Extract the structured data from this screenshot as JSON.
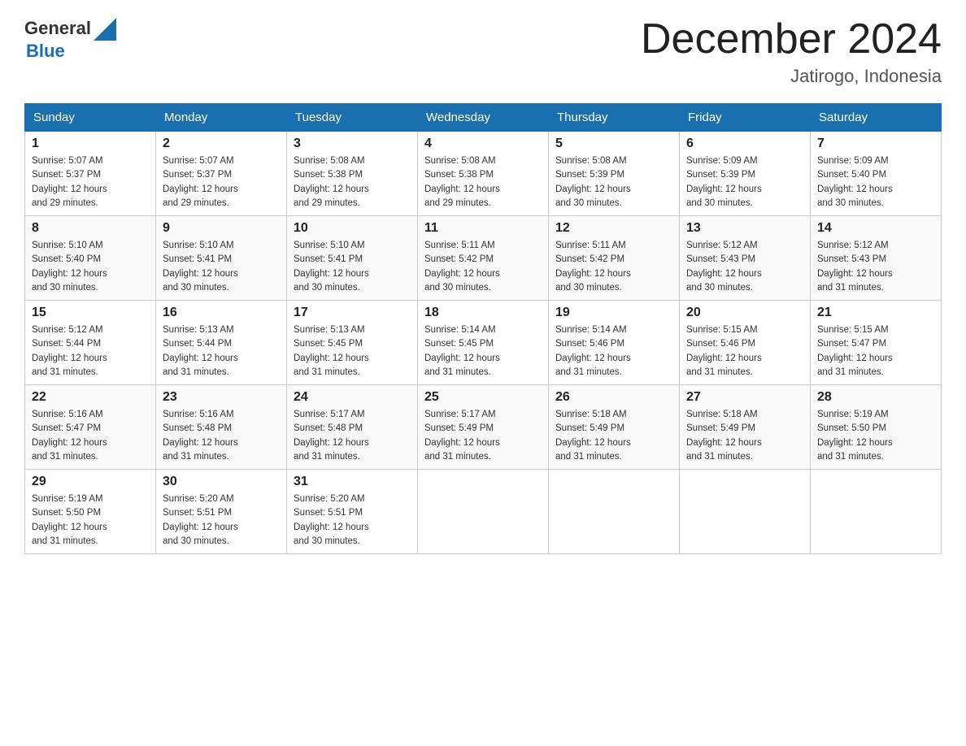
{
  "header": {
    "logo_text_general": "General",
    "logo_text_blue": "Blue",
    "month_title": "December 2024",
    "location": "Jatirogo, Indonesia"
  },
  "days_of_week": [
    "Sunday",
    "Monday",
    "Tuesday",
    "Wednesday",
    "Thursday",
    "Friday",
    "Saturday"
  ],
  "weeks": [
    {
      "days": [
        {
          "number": "1",
          "sunrise": "5:07 AM",
          "sunset": "5:37 PM",
          "daylight": "12 hours and 29 minutes."
        },
        {
          "number": "2",
          "sunrise": "5:07 AM",
          "sunset": "5:37 PM",
          "daylight": "12 hours and 29 minutes."
        },
        {
          "number": "3",
          "sunrise": "5:08 AM",
          "sunset": "5:38 PM",
          "daylight": "12 hours and 29 minutes."
        },
        {
          "number": "4",
          "sunrise": "5:08 AM",
          "sunset": "5:38 PM",
          "daylight": "12 hours and 29 minutes."
        },
        {
          "number": "5",
          "sunrise": "5:08 AM",
          "sunset": "5:39 PM",
          "daylight": "12 hours and 30 minutes."
        },
        {
          "number": "6",
          "sunrise": "5:09 AM",
          "sunset": "5:39 PM",
          "daylight": "12 hours and 30 minutes."
        },
        {
          "number": "7",
          "sunrise": "5:09 AM",
          "sunset": "5:40 PM",
          "daylight": "12 hours and 30 minutes."
        }
      ]
    },
    {
      "days": [
        {
          "number": "8",
          "sunrise": "5:10 AM",
          "sunset": "5:40 PM",
          "daylight": "12 hours and 30 minutes."
        },
        {
          "number": "9",
          "sunrise": "5:10 AM",
          "sunset": "5:41 PM",
          "daylight": "12 hours and 30 minutes."
        },
        {
          "number": "10",
          "sunrise": "5:10 AM",
          "sunset": "5:41 PM",
          "daylight": "12 hours and 30 minutes."
        },
        {
          "number": "11",
          "sunrise": "5:11 AM",
          "sunset": "5:42 PM",
          "daylight": "12 hours and 30 minutes."
        },
        {
          "number": "12",
          "sunrise": "5:11 AM",
          "sunset": "5:42 PM",
          "daylight": "12 hours and 30 minutes."
        },
        {
          "number": "13",
          "sunrise": "5:12 AM",
          "sunset": "5:43 PM",
          "daylight": "12 hours and 30 minutes."
        },
        {
          "number": "14",
          "sunrise": "5:12 AM",
          "sunset": "5:43 PM",
          "daylight": "12 hours and 31 minutes."
        }
      ]
    },
    {
      "days": [
        {
          "number": "15",
          "sunrise": "5:12 AM",
          "sunset": "5:44 PM",
          "daylight": "12 hours and 31 minutes."
        },
        {
          "number": "16",
          "sunrise": "5:13 AM",
          "sunset": "5:44 PM",
          "daylight": "12 hours and 31 minutes."
        },
        {
          "number": "17",
          "sunrise": "5:13 AM",
          "sunset": "5:45 PM",
          "daylight": "12 hours and 31 minutes."
        },
        {
          "number": "18",
          "sunrise": "5:14 AM",
          "sunset": "5:45 PM",
          "daylight": "12 hours and 31 minutes."
        },
        {
          "number": "19",
          "sunrise": "5:14 AM",
          "sunset": "5:46 PM",
          "daylight": "12 hours and 31 minutes."
        },
        {
          "number": "20",
          "sunrise": "5:15 AM",
          "sunset": "5:46 PM",
          "daylight": "12 hours and 31 minutes."
        },
        {
          "number": "21",
          "sunrise": "5:15 AM",
          "sunset": "5:47 PM",
          "daylight": "12 hours and 31 minutes."
        }
      ]
    },
    {
      "days": [
        {
          "number": "22",
          "sunrise": "5:16 AM",
          "sunset": "5:47 PM",
          "daylight": "12 hours and 31 minutes."
        },
        {
          "number": "23",
          "sunrise": "5:16 AM",
          "sunset": "5:48 PM",
          "daylight": "12 hours and 31 minutes."
        },
        {
          "number": "24",
          "sunrise": "5:17 AM",
          "sunset": "5:48 PM",
          "daylight": "12 hours and 31 minutes."
        },
        {
          "number": "25",
          "sunrise": "5:17 AM",
          "sunset": "5:49 PM",
          "daylight": "12 hours and 31 minutes."
        },
        {
          "number": "26",
          "sunrise": "5:18 AM",
          "sunset": "5:49 PM",
          "daylight": "12 hours and 31 minutes."
        },
        {
          "number": "27",
          "sunrise": "5:18 AM",
          "sunset": "5:49 PM",
          "daylight": "12 hours and 31 minutes."
        },
        {
          "number": "28",
          "sunrise": "5:19 AM",
          "sunset": "5:50 PM",
          "daylight": "12 hours and 31 minutes."
        }
      ]
    },
    {
      "days": [
        {
          "number": "29",
          "sunrise": "5:19 AM",
          "sunset": "5:50 PM",
          "daylight": "12 hours and 31 minutes."
        },
        {
          "number": "30",
          "sunrise": "5:20 AM",
          "sunset": "5:51 PM",
          "daylight": "12 hours and 30 minutes."
        },
        {
          "number": "31",
          "sunrise": "5:20 AM",
          "sunset": "5:51 PM",
          "daylight": "12 hours and 30 minutes."
        },
        null,
        null,
        null,
        null
      ]
    }
  ],
  "labels": {
    "sunrise": "Sunrise:",
    "sunset": "Sunset:",
    "daylight": "Daylight:"
  }
}
